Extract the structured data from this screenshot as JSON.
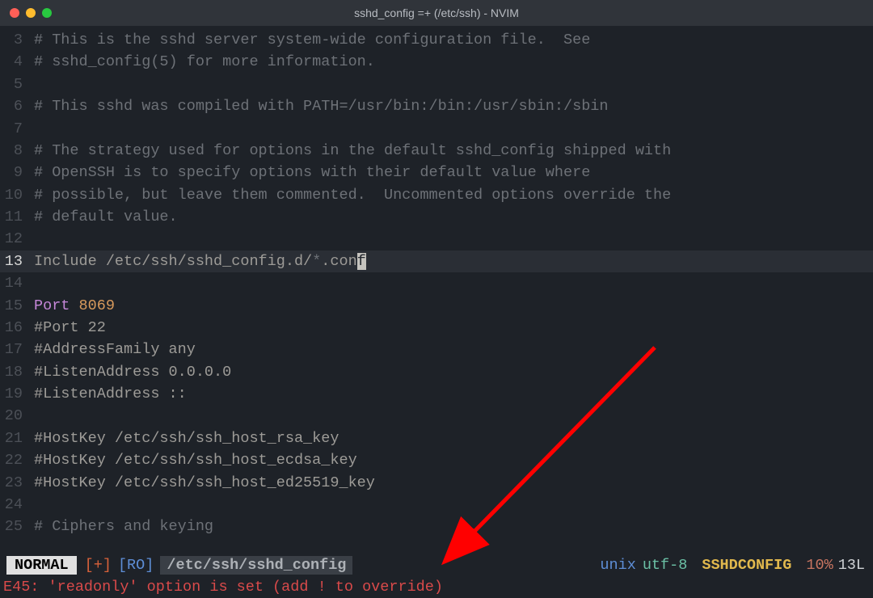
{
  "window": {
    "title": "sshd_config =+ (/etc/ssh) - NVIM"
  },
  "lines": [
    {
      "num": "3",
      "type": "comment",
      "text": "# This is the sshd server system-wide configuration file.  See"
    },
    {
      "num": "4",
      "type": "comment",
      "text": "# sshd_config(5) for more information."
    },
    {
      "num": "5",
      "type": "empty",
      "text": ""
    },
    {
      "num": "6",
      "type": "comment",
      "text": "# This sshd was compiled with PATH=/usr/bin:/bin:/usr/sbin:/sbin"
    },
    {
      "num": "7",
      "type": "empty",
      "text": ""
    },
    {
      "num": "8",
      "type": "comment",
      "text": "# The strategy used for options in the default sshd_config shipped with"
    },
    {
      "num": "9",
      "type": "comment",
      "text": "# OpenSSH is to specify options with their default value where"
    },
    {
      "num": "10",
      "type": "comment",
      "text": "# possible, but leave them commented.  Uncommented options override the"
    },
    {
      "num": "11",
      "type": "comment",
      "text": "# default value."
    },
    {
      "num": "12",
      "type": "empty",
      "text": ""
    },
    {
      "num": "13",
      "type": "include",
      "pre": "Include /etc/ssh/sshd_config.d/",
      "glob": "*",
      "post": ".con",
      "cursor": "f",
      "current": true
    },
    {
      "num": "14",
      "type": "empty",
      "text": ""
    },
    {
      "num": "15",
      "type": "port",
      "kw": "Port",
      "val": " 8069"
    },
    {
      "num": "16",
      "type": "plain",
      "text": "#Port 22"
    },
    {
      "num": "17",
      "type": "plain",
      "text": "#AddressFamily any"
    },
    {
      "num": "18",
      "type": "plain",
      "text": "#ListenAddress 0.0.0.0"
    },
    {
      "num": "19",
      "type": "plain",
      "text": "#ListenAddress ::"
    },
    {
      "num": "20",
      "type": "empty",
      "text": ""
    },
    {
      "num": "21",
      "type": "plain",
      "text": "#HostKey /etc/ssh/ssh_host_rsa_key"
    },
    {
      "num": "22",
      "type": "plain",
      "text": "#HostKey /etc/ssh/ssh_host_ecdsa_key"
    },
    {
      "num": "23",
      "type": "plain",
      "text": "#HostKey /etc/ssh/ssh_host_ed25519_key"
    },
    {
      "num": "24",
      "type": "empty",
      "text": ""
    },
    {
      "num": "25",
      "type": "comment",
      "text": "# Ciphers and keying"
    }
  ],
  "statusline": {
    "mode": "NORMAL",
    "modified": "[+]",
    "readonly": "[RO]",
    "path": "/etc/ssh/sshd_config",
    "fileformat": "unix",
    "encoding": "utf-8",
    "filetype": "SSHDCONFIG",
    "percent": "10%",
    "lines": "13L"
  },
  "cmdline": {
    "error": "E45: 'readonly' option is set (add ! to override)"
  }
}
